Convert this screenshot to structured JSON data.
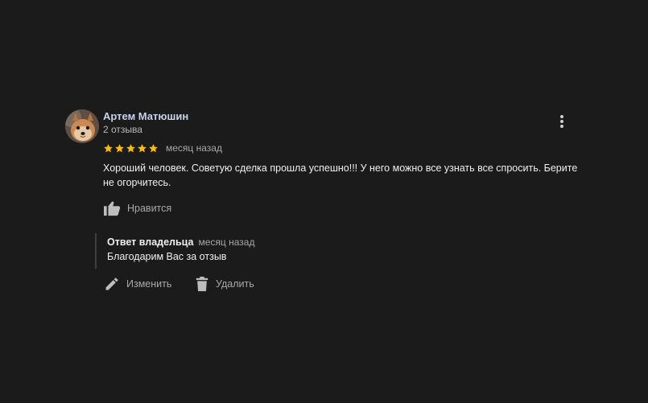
{
  "review": {
    "author_name": "Артем Матюшин",
    "author_review_count": "2 отзыва",
    "avatar_icon": "dog-avatar-photo",
    "rating": 5,
    "rating_max": 5,
    "date": "месяц назад",
    "text": "Хороший человек. Советую сделка прошла успешно!!! У него можно все узнать все спросить. Берите не огорчитесь.",
    "like_label": "Нравится",
    "like_icon": "thumbs-up-icon",
    "more_icon": "more-vertical-icon",
    "star_color": "#fbbc04"
  },
  "owner_reply": {
    "title": "Ответ владельца",
    "date": "месяц назад",
    "text": "Благодарим Вас за отзыв"
  },
  "actions": {
    "edit_label": "Изменить",
    "edit_icon": "pencil-icon",
    "delete_label": "Удалить",
    "delete_icon": "trash-icon"
  }
}
